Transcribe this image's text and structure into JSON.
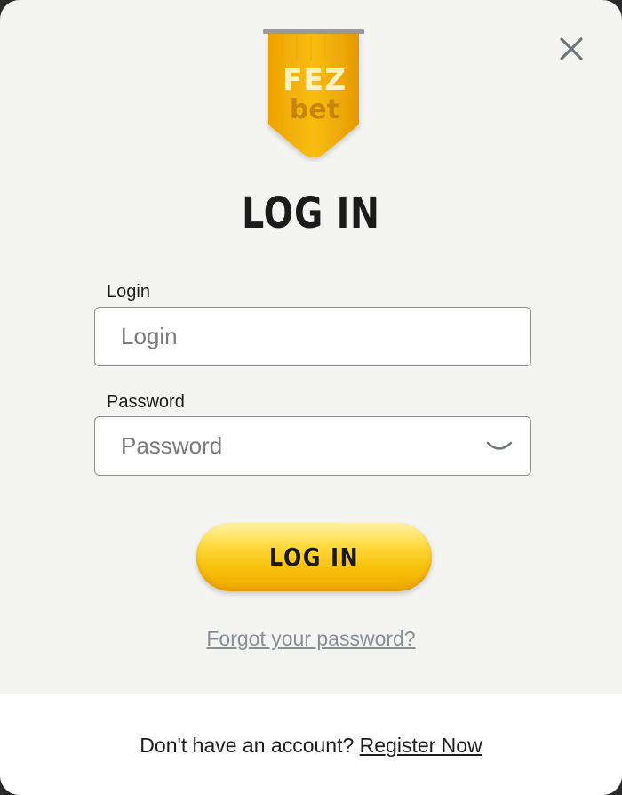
{
  "dialog": {
    "close_icon": "close-icon",
    "logo": {
      "line1": "FEZ",
      "line2": "bet",
      "colors": {
        "banner": "#f6b60a",
        "banner_shadow": "#e39a00"
      }
    },
    "title": "LOG IN"
  },
  "form": {
    "login": {
      "label": "Login",
      "placeholder": "Login",
      "value": ""
    },
    "password": {
      "label": "Password",
      "placeholder": "Password",
      "value": "",
      "toggle_icon": "eye-closed-icon"
    },
    "submit_label": "LOG IN",
    "forgot_label": "Forgot your password?"
  },
  "footer": {
    "prompt": "Don't have an account? ",
    "register_label": "Register Now"
  },
  "colors": {
    "accent": "#f8c10e",
    "muted_link": "#8a8f93",
    "background": "#f4f4f3"
  }
}
